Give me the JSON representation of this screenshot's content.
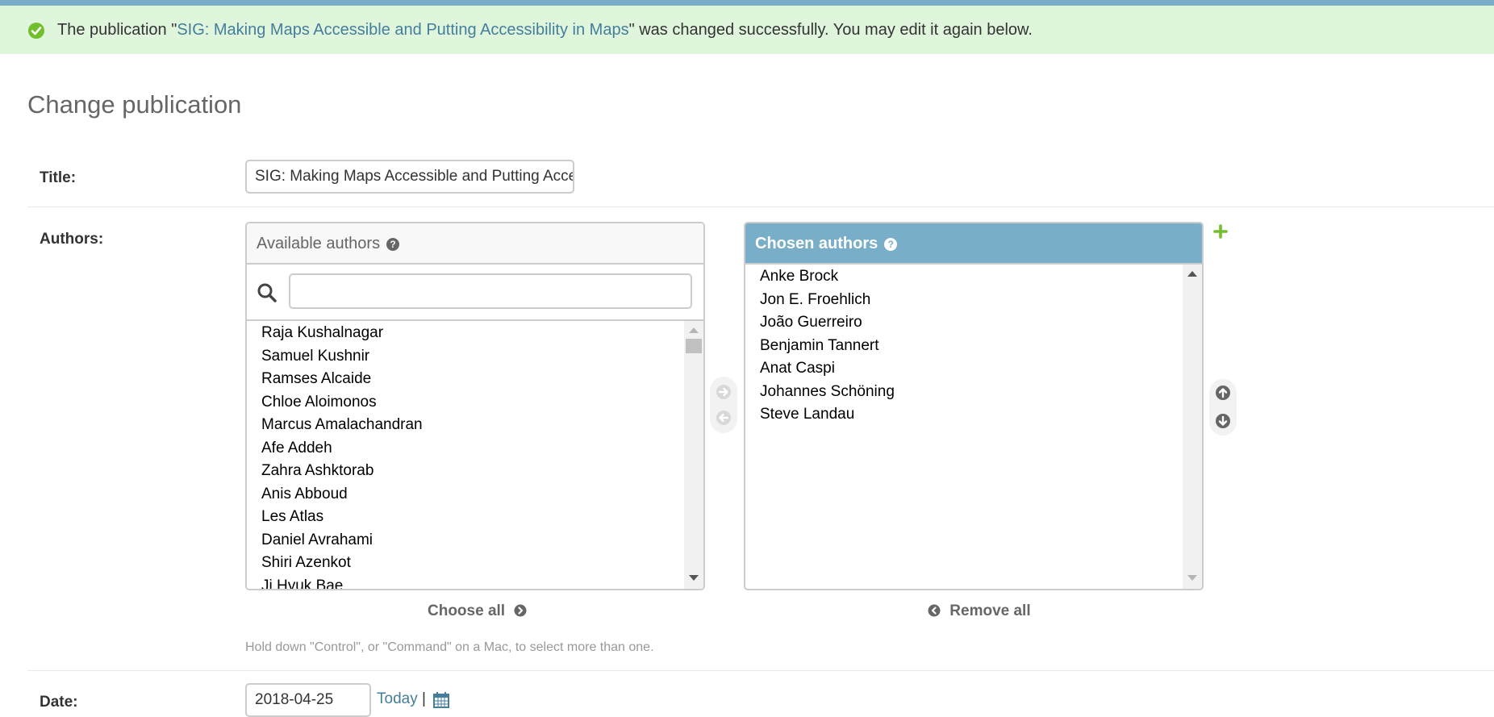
{
  "message": {
    "prefix": "The publication \"",
    "link": "SIG: Making Maps Accessible and Putting Accessibility in Maps",
    "suffix": "\" was changed successfully. You may edit it again below."
  },
  "page": {
    "title": "Change publication"
  },
  "fields": {
    "title_label": "Title:",
    "title_value": "SIG: Making Maps Accessible and Putting Accessibility in Maps",
    "authors_label": "Authors:",
    "date_label": "Date:",
    "date_value": "2018-04-25",
    "today_link": "Today",
    "date_separator": "|"
  },
  "authors": {
    "available_title": "Available authors",
    "chosen_title": "Chosen authors",
    "available": [
      "Raja Kushalnagar",
      "Samuel Kushnir",
      "Ramses Alcaide",
      "Chloe Aloimonos",
      "Marcus Amalachandran",
      "Afe Addeh",
      "Zahra Ashktorab",
      "Anis Abboud",
      "Les Atlas",
      "Daniel Avrahami",
      "Shiri Azenkot",
      "Ji Hyuk Bae"
    ],
    "chosen": [
      "Anke Brock",
      "Jon E. Froehlich",
      "João Guerreiro",
      "Benjamin Tannert",
      "Anat Caspi",
      "Johannes Schöning",
      "Steve Landau"
    ],
    "choose_all": "Choose all",
    "remove_all": "Remove all",
    "help_text": "Hold down \"Control\", or \"Command\" on a Mac, to select more than one.",
    "help_icon_glyph": "?"
  },
  "icons": {
    "success": "check-circle-icon",
    "search": "search-icon",
    "add": "plus-icon",
    "calendar": "calendar-icon"
  },
  "colors": {
    "header_bar": "#79aec8",
    "success_bg": "#dff6dd",
    "success_icon": "#70bf2b",
    "link": "#447e9b",
    "add_icon": "#70bf2b"
  }
}
